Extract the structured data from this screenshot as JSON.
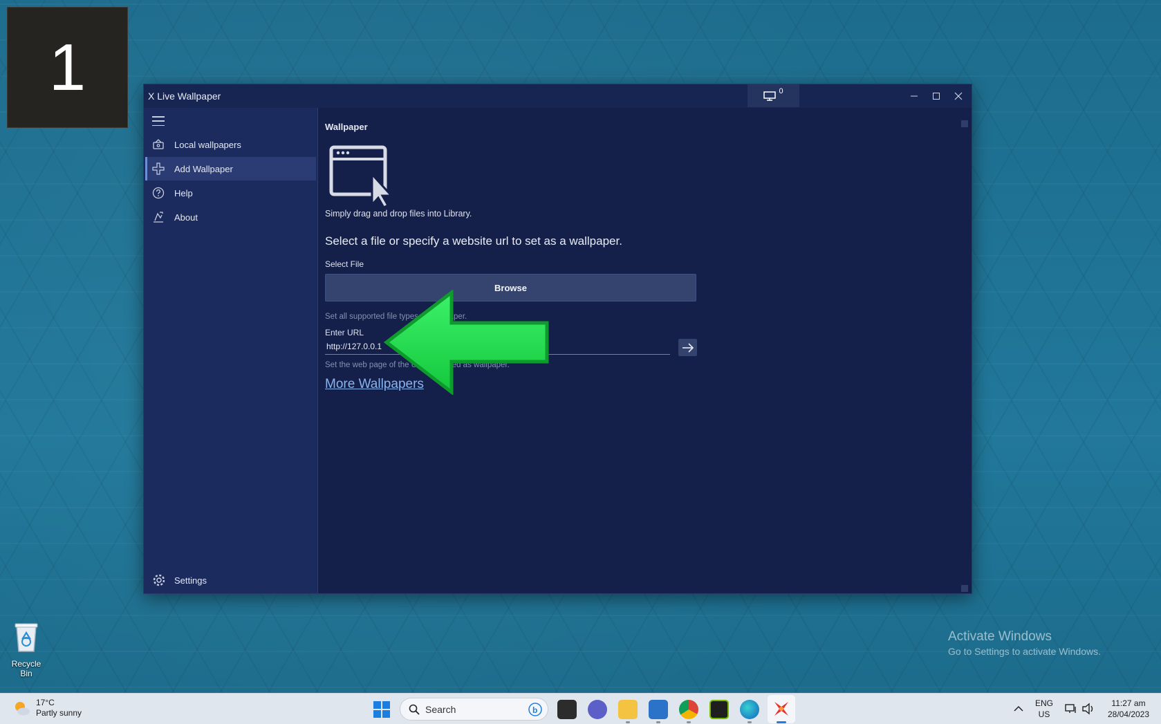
{
  "desktop": {
    "number_tile": "1",
    "recycle_bin_label": "Recycle Bin",
    "activate_title": "Activate Windows",
    "activate_subtitle": "Go to Settings to activate Windows."
  },
  "window": {
    "title": "X Live Wallpaper",
    "monitor_count": "0"
  },
  "sidebar": {
    "items": [
      {
        "label": "Local wallpapers",
        "icon": "library-icon"
      },
      {
        "label": "Add Wallpaper",
        "icon": "add-icon",
        "active": true
      },
      {
        "label": "Help",
        "icon": "help-icon"
      },
      {
        "label": "About",
        "icon": "about-icon"
      }
    ],
    "settings_label": "Settings"
  },
  "content": {
    "section_title": "Wallpaper",
    "drop_hint": "Simply drag and drop files into Library.",
    "heading": "Select a file or specify a website url to set as a wallpaper.",
    "select_file_label": "Select File",
    "browse_label": "Browse",
    "file_hint": "Set all supported file types as wallpaper.",
    "url_label": "Enter URL",
    "url_value": "http://127.0.0.1",
    "url_hint": "Set the web page of the URL rendered as wallpaper.",
    "more_link": "More Wallpapers"
  },
  "taskbar": {
    "weather_temp": "17°C",
    "weather_desc": "Partly sunny",
    "search_placeholder": "Search",
    "lang_top": "ENG",
    "lang_bottom": "US",
    "time": "11:27 am",
    "date": "28/04/2023"
  },
  "colors": {
    "window_bg": "#15204a",
    "sidebar_bg": "#1c2b5e",
    "accent_arrow": "#1ed94a",
    "link": "#8ab4f0"
  }
}
